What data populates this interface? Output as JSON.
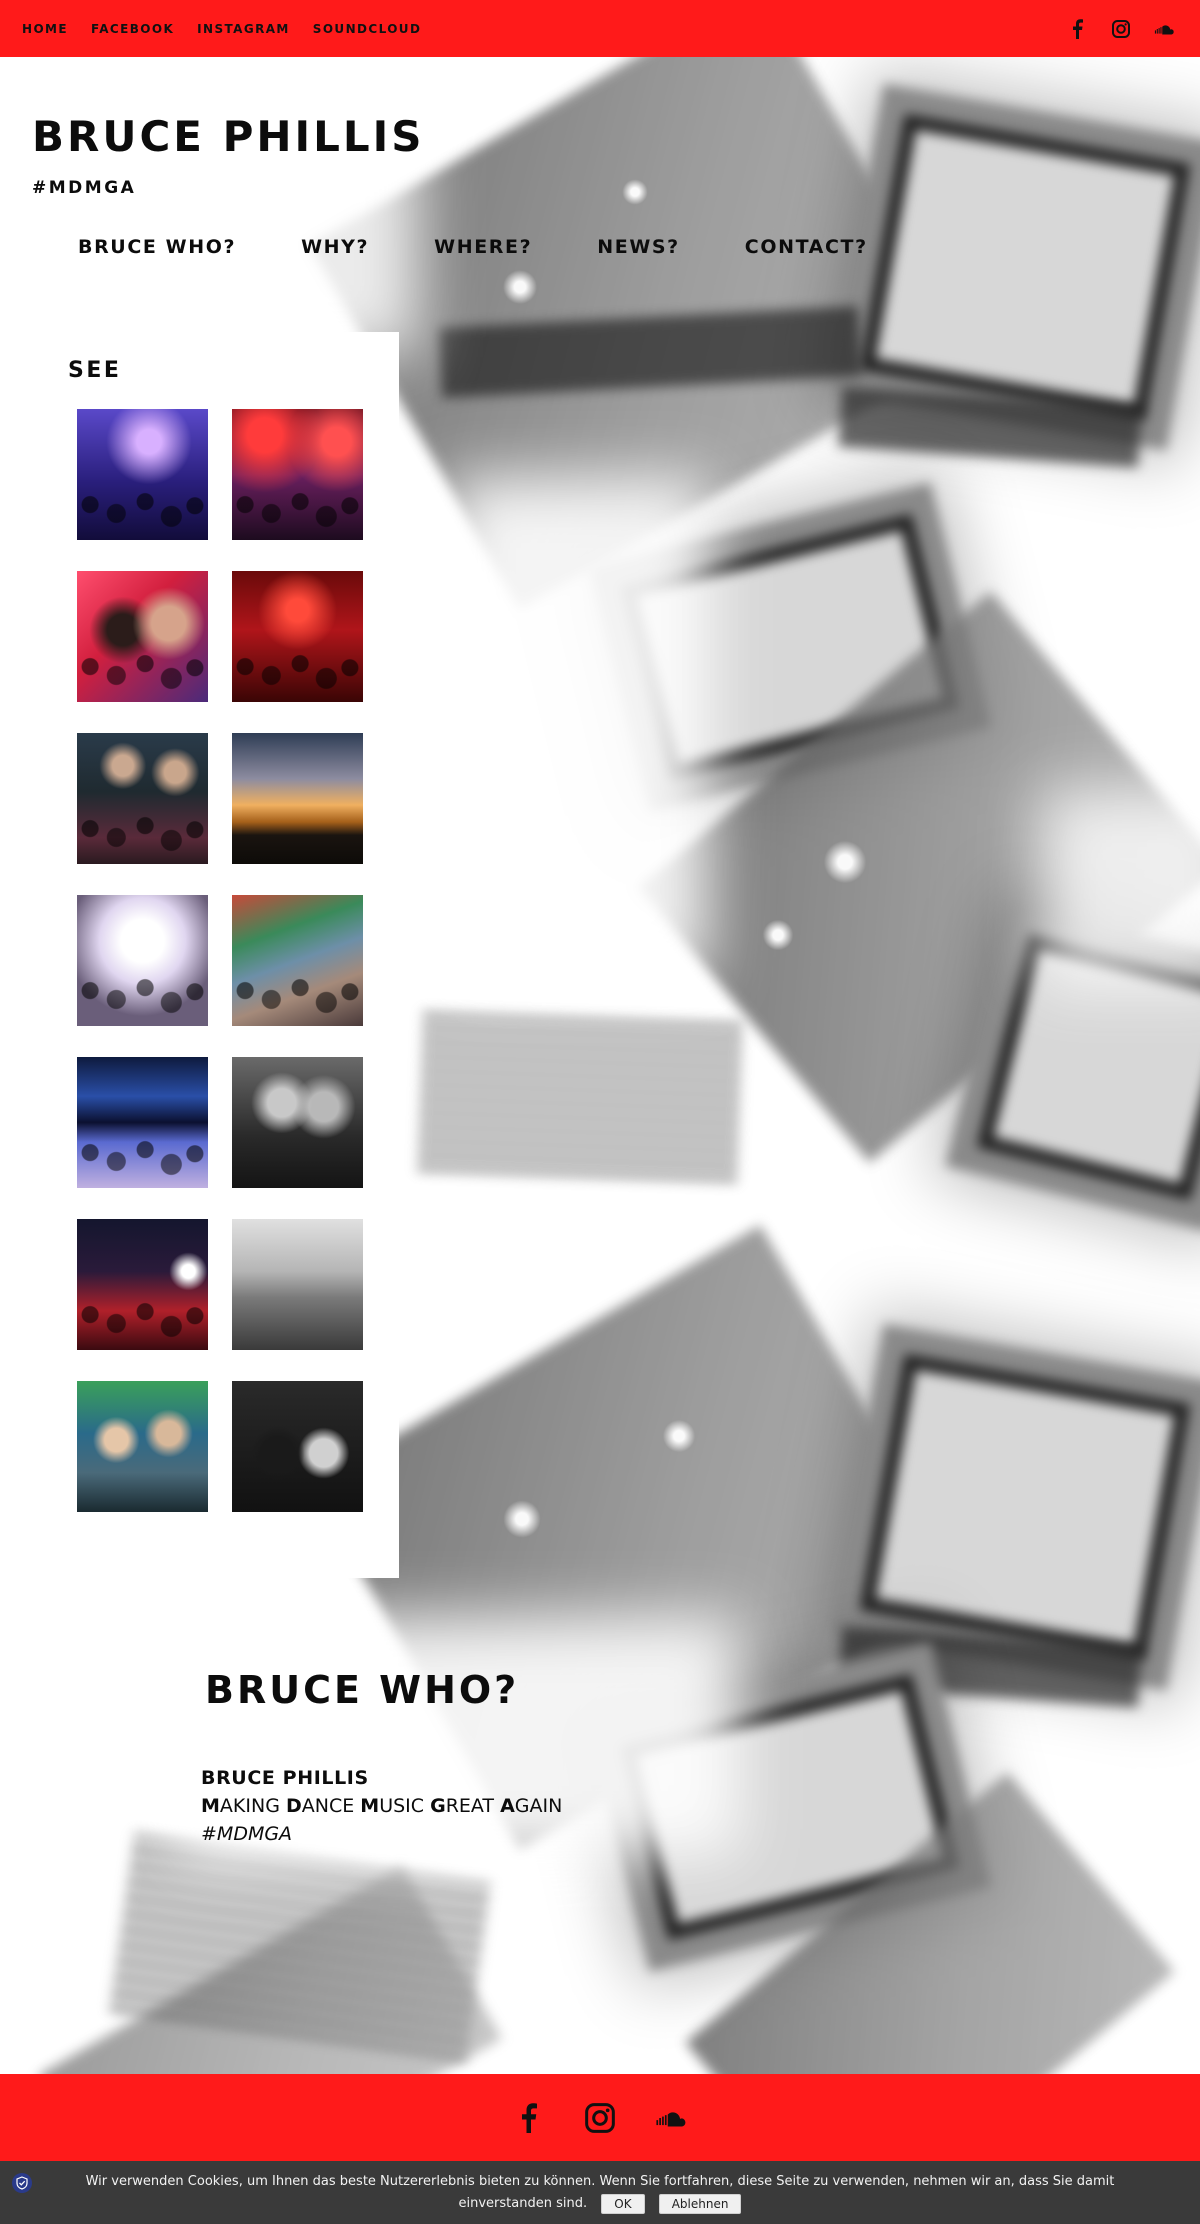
{
  "topbar": {
    "nav": [
      "HOME",
      "FACEBOOK",
      "INSTAGRAM",
      "SOUNDCLOUD"
    ],
    "icons": [
      "facebook-icon",
      "instagram-icon",
      "soundcloud-icon"
    ],
    "background_color": "#ff1a1a"
  },
  "header": {
    "title": "BRUCE PHILLIS",
    "tagline": "#MDMGA",
    "nav": [
      "BRUCE WHO?",
      "WHY?",
      "WHERE?",
      "NEWS?",
      "CONTACT?"
    ]
  },
  "gallery": {
    "heading": "SEE",
    "photos": [
      "crowd under blue-purple light",
      "club crowd in red-purple light",
      "two DJs at the decks, red tint",
      "red-lit club crowd",
      "two DJs at a mixing booth",
      "sunset outdoor set",
      "white fog over crowd",
      "daytime festival crowd",
      "blue-lit club crowd collage",
      "black-and-white DJ duo portrait",
      "crowd with red lights",
      "DJ booth by the harbour",
      "DJs under green decor",
      "black-and-white crowd from behind"
    ]
  },
  "about": {
    "heading": "BRUCE WHO?",
    "name": "BRUCE PHILLIS",
    "motto_parts": [
      {
        "initial": "M",
        "rest": "AKING "
      },
      {
        "initial": "D",
        "rest": "ANCE "
      },
      {
        "initial": "M",
        "rest": "USIC "
      },
      {
        "initial": "G",
        "rest": "REAT "
      },
      {
        "initial": "A",
        "rest": "GAIN"
      }
    ],
    "hashtag": "#MDMGA"
  },
  "footer": {
    "icons": [
      "facebook-icon",
      "instagram-icon",
      "soundcloud-icon"
    ],
    "background_color": "#ff1a1a"
  },
  "cookie": {
    "message": "Wir verwenden Cookies, um Ihnen das beste Nutzererlebnis bieten zu können. Wenn Sie fortfahren, diese Seite zu verwenden, nehmen wir an, dass Sie damit einverstanden sind.",
    "ok_label": "OK",
    "decline_label": "Ablehnen",
    "background_color": "#3a3a3a"
  }
}
